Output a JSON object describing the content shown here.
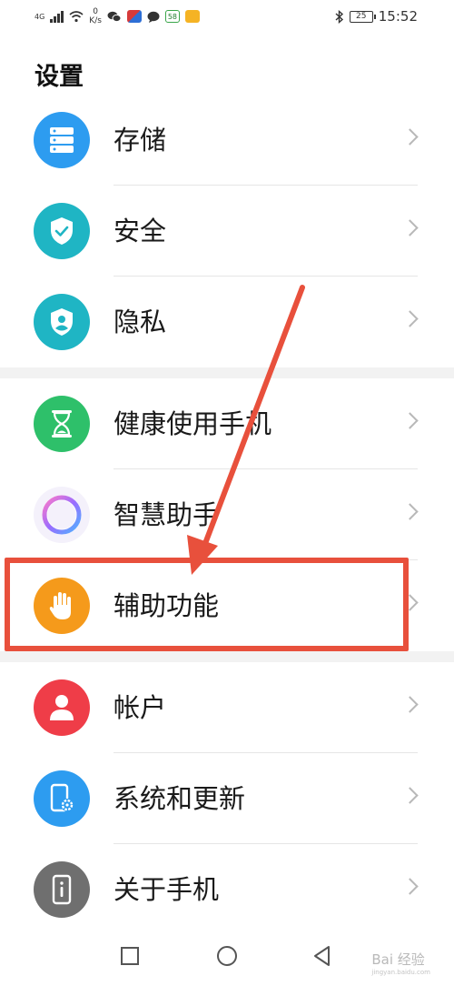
{
  "status_bar": {
    "network_type": "4G",
    "net_speed_value": "0",
    "net_speed_unit": "K/s",
    "badge": "58",
    "battery_level": "25",
    "time": "15:52"
  },
  "page": {
    "title": "设置"
  },
  "settings": [
    {
      "label": "存储",
      "icon": "storage-icon",
      "color": "#2d9cf0"
    },
    {
      "label": "安全",
      "icon": "shield-check-icon",
      "color": "#1fb5c4"
    },
    {
      "label": "隐私",
      "icon": "privacy-icon",
      "color": "#1fb5c4"
    },
    {
      "label": "健康使用手机",
      "icon": "hourglass-icon",
      "color": "#2ec06a"
    },
    {
      "label": "智慧助手",
      "icon": "assistant-ring-icon",
      "color": "#b98cf0"
    },
    {
      "label": "辅助功能",
      "icon": "hand-icon",
      "color": "#f59a1b"
    },
    {
      "label": "帐户",
      "icon": "user-icon",
      "color": "#ef3d48"
    },
    {
      "label": "系统和更新",
      "icon": "phone-gear-icon",
      "color": "#2d9cf0"
    },
    {
      "label": "关于手机",
      "icon": "phone-info-icon",
      "color": "#6f6f6f"
    }
  ],
  "annotation": {
    "color": "#e8503c"
  },
  "watermark": {
    "text": "Bai 经验",
    "sub": "jingyan.baidu.com"
  }
}
